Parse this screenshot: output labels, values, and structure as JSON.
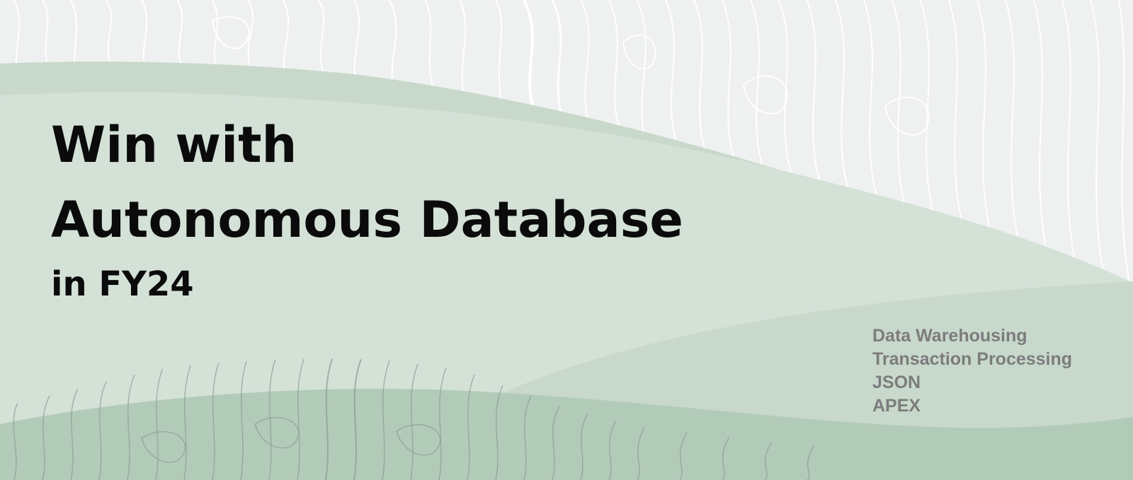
{
  "banner": {
    "headline": {
      "line1": "Win with",
      "line2": "Autonomous Database",
      "line3": "in FY24"
    },
    "topics": [
      "Data Warehousing",
      "Transaction Processing",
      "JSON",
      "APEX"
    ],
    "background_art": {
      "description_icon": "topographic-contour-pattern",
      "colors": {
        "paper": "#eef1ef",
        "contour_light": "#ffffff",
        "wave_light": "#d4e1d7",
        "wave_mid": "#c8d9cc",
        "wave_dark": "#b2cab8",
        "contour_dark": "#8a9b90"
      }
    }
  }
}
